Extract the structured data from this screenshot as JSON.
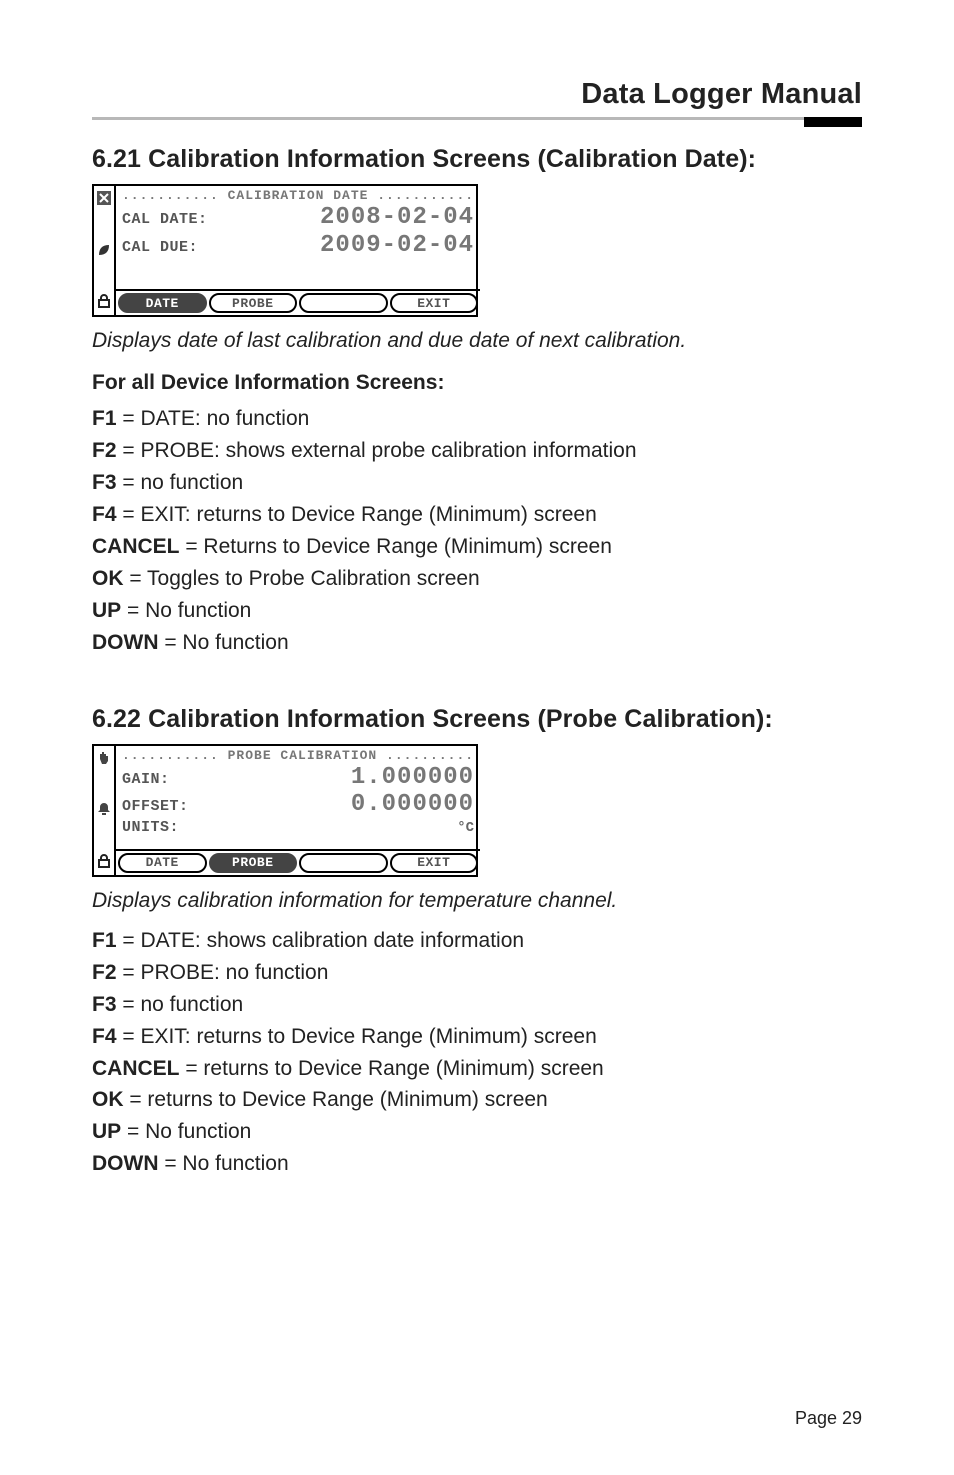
{
  "header": {
    "title": "Data Logger Manual"
  },
  "section_621": {
    "heading": "6.21 Calibration Information Screens (Calibration Date):",
    "lcd": {
      "title": "........... CALIBRATION DATE ...........",
      "icons": {
        "top": "x-icon",
        "middle": "leaf-icon",
        "bottom": "lock-icon"
      },
      "rows": [
        {
          "label": "CAL DATE:",
          "value": "2008-02-04"
        },
        {
          "label": "CAL DUE:",
          "value": "2009-02-04"
        }
      ],
      "softkeys": [
        {
          "label": "DATE",
          "active": true
        },
        {
          "label": "PROBE",
          "active": false
        },
        {
          "label": "",
          "active": false
        },
        {
          "label": "EXIT",
          "active": false
        }
      ]
    },
    "caption": "Displays date of last calibration and due date of next calibration.",
    "subheading": "For all Device Information Screens:",
    "defs": {
      "f1": {
        "key": "F1",
        "text": " = DATE: no function"
      },
      "f2": {
        "key": "F2",
        "text": " = PROBE: shows external probe calibration information"
      },
      "f3": {
        "key": "F3",
        "text": " = no function"
      },
      "f4": {
        "key": "F4",
        "text": " = EXIT: returns to Device Range (Minimum) screen"
      },
      "cancel": {
        "key": "CANCEL",
        "text": " = Returns to Device Range (Minimum) screen"
      },
      "ok": {
        "key": "OK",
        "text": " = Toggles to Probe Calibration screen"
      },
      "up": {
        "key": "UP",
        "text": " = No function"
      },
      "down": {
        "key": "DOWN",
        "text": " = No function"
      }
    }
  },
  "section_622": {
    "heading": "6.22 Calibration Information Screens (Probe Calibration):",
    "lcd": {
      "title": "........... PROBE CALIBRATION ..........",
      "icons": {
        "top": "hand-icon",
        "middle": "bell-icon",
        "bottom": "lock-icon"
      },
      "rows": [
        {
          "label": "GAIN:",
          "value": "1.000000"
        },
        {
          "label": "OFFSET:",
          "value": "0.000000"
        },
        {
          "label": "UNITS:",
          "value": "°C"
        }
      ],
      "softkeys": [
        {
          "label": "DATE",
          "active": false
        },
        {
          "label": "PROBE",
          "active": true
        },
        {
          "label": "",
          "active": false
        },
        {
          "label": "EXIT",
          "active": false
        }
      ]
    },
    "caption": "Displays calibration information for temperature channel.",
    "defs": {
      "f1": {
        "key": "F1",
        "text": " = DATE: shows calibration date information"
      },
      "f2": {
        "key": "F2",
        "text": " = PROBE: no function"
      },
      "f3": {
        "key": "F3",
        "text": " = no function"
      },
      "f4": {
        "key": "F4",
        "text": " = EXIT: returns to Device Range (Minimum) screen"
      },
      "cancel": {
        "key": "CANCEL",
        "text": " = returns to Device Range (Minimum) screen"
      },
      "ok": {
        "key": "OK",
        "text": " = returns to Device Range (Minimum) screen"
      },
      "up": {
        "key": "UP",
        "text": " = No function"
      },
      "down": {
        "key": "DOWN",
        "text": " = No function"
      }
    }
  },
  "footer": {
    "page": "Page 29"
  }
}
